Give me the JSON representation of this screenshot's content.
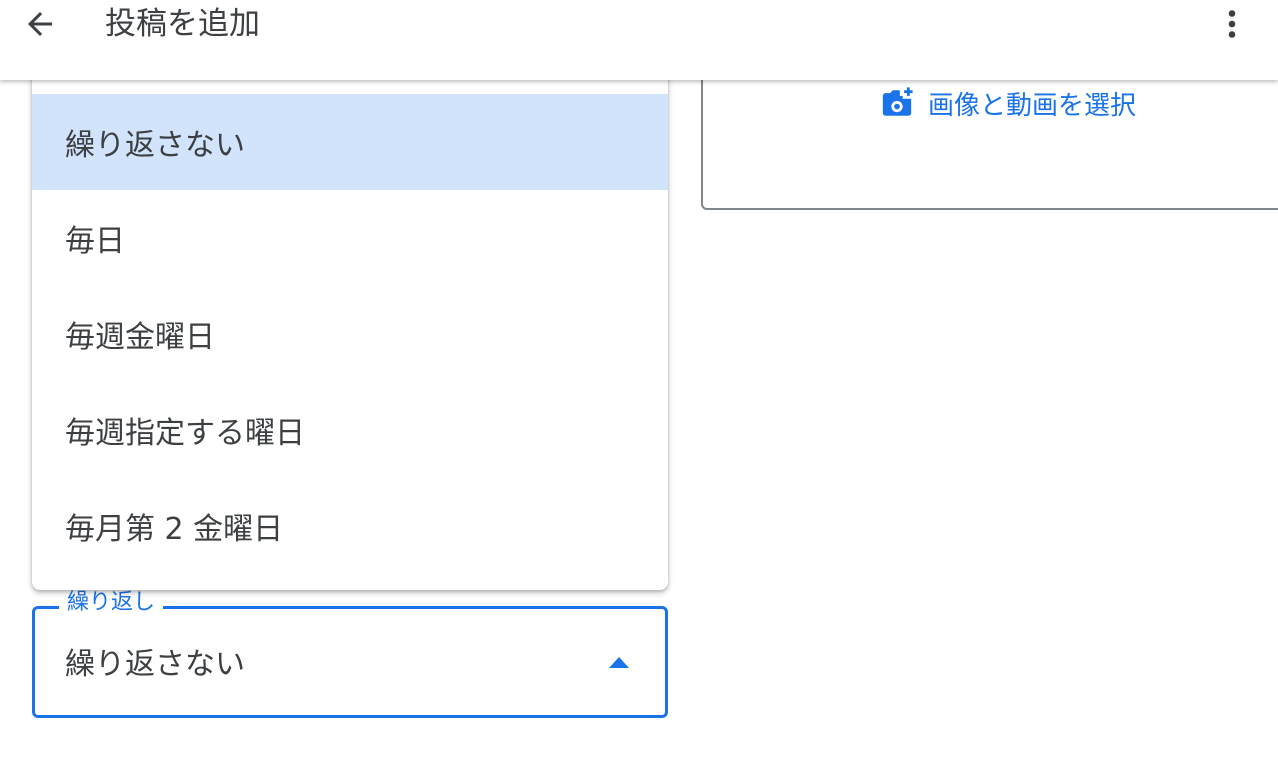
{
  "header": {
    "title": "投稿を追加",
    "back_icon": "arrow-back-icon",
    "more_icon": "more-vert-icon"
  },
  "media": {
    "select_label": "画像と動画を選択",
    "icon": "add-photo-icon"
  },
  "repeat_dropdown": {
    "options": [
      {
        "label": "繰り返さない",
        "selected": true
      },
      {
        "label": "毎日",
        "selected": false
      },
      {
        "label": "毎週金曜日",
        "selected": false
      },
      {
        "label": "毎週指定する曜日",
        "selected": false
      },
      {
        "label": "毎月第 2 金曜日",
        "selected": false
      }
    ]
  },
  "repeat_field": {
    "label": "繰り返し",
    "value": "繰り返さない"
  },
  "colors": {
    "accent": "#1a73e8",
    "selected_bg": "#d2e3fc",
    "text": "#3c4043"
  }
}
